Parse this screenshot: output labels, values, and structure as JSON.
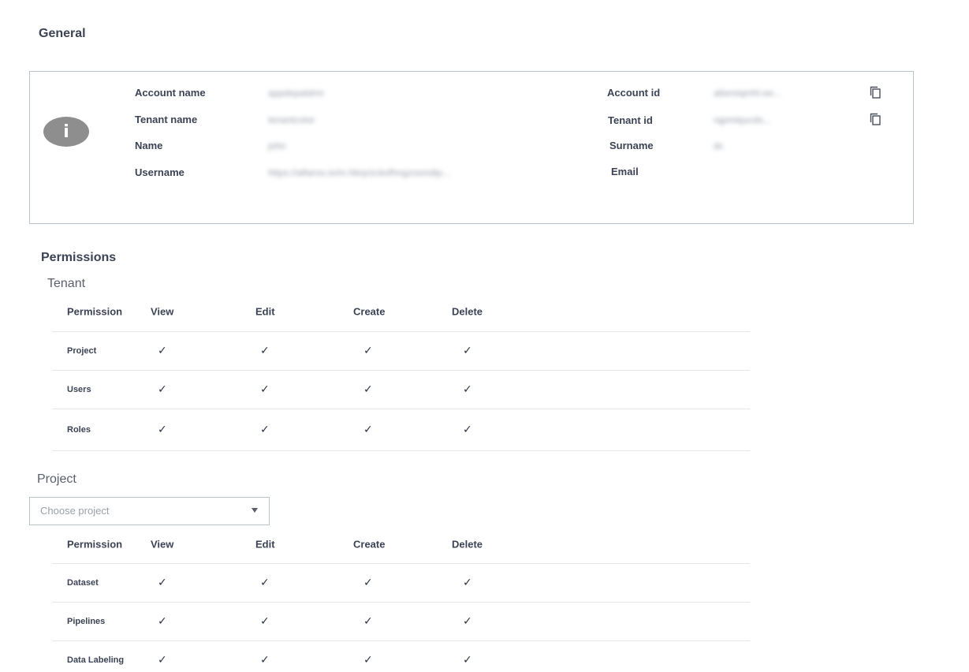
{
  "general": {
    "title": "General",
    "fields": {
      "account_name": {
        "label": "Account name",
        "value": "appdepatdrm"
      },
      "tenant_name": {
        "label": "Tenant name",
        "value": "tenantcolor"
      },
      "name": {
        "label": "Name",
        "value": "john"
      },
      "username": {
        "label": "Username",
        "value": "https://alfaroo.io/m.hbrp/zcksfhngzssmdip..."
      },
      "account_id": {
        "label": "Account id",
        "value": "a6emiqmhl-ee..."
      },
      "tenant_id": {
        "label": "Tenant id",
        "value": "rqpmtqucds..."
      },
      "surname": {
        "label": "Surname",
        "value": "dc"
      },
      "email": {
        "label": "Email",
        "value": ""
      }
    },
    "info_icon_glyph": "i"
  },
  "permissions": {
    "title": "Permissions",
    "tenant": {
      "title": "Tenant",
      "headers": [
        "Permission",
        "View",
        "Edit",
        "Create",
        "Delete"
      ],
      "rows": [
        {
          "name": "Project",
          "view": "✓",
          "edit": "✓",
          "create": "✓",
          "delete": "✓"
        },
        {
          "name": "Users",
          "view": "✓",
          "edit": "✓",
          "create": "✓",
          "delete": "✓"
        },
        {
          "name": "Roles",
          "view": "✓",
          "edit": "✓",
          "create": "✓",
          "delete": "✓"
        }
      ]
    },
    "project": {
      "title": "Project",
      "select_placeholder": "Choose project",
      "headers": [
        "Permission",
        "View",
        "Edit",
        "Create",
        "Delete"
      ],
      "rows": [
        {
          "name": "Dataset",
          "view": "✓",
          "edit": "✓",
          "create": "✓",
          "delete": "✓"
        },
        {
          "name": "Pipelines",
          "view": "✓",
          "edit": "✓",
          "create": "✓",
          "delete": "✓"
        },
        {
          "name": "Data Labeling",
          "view": "✓",
          "edit": "✓",
          "create": "✓",
          "delete": "✓"
        }
      ]
    }
  },
  "colors": {
    "border": "#b9c5cc",
    "text": "#3b4355",
    "icon_bg": "#8e8e8e"
  }
}
